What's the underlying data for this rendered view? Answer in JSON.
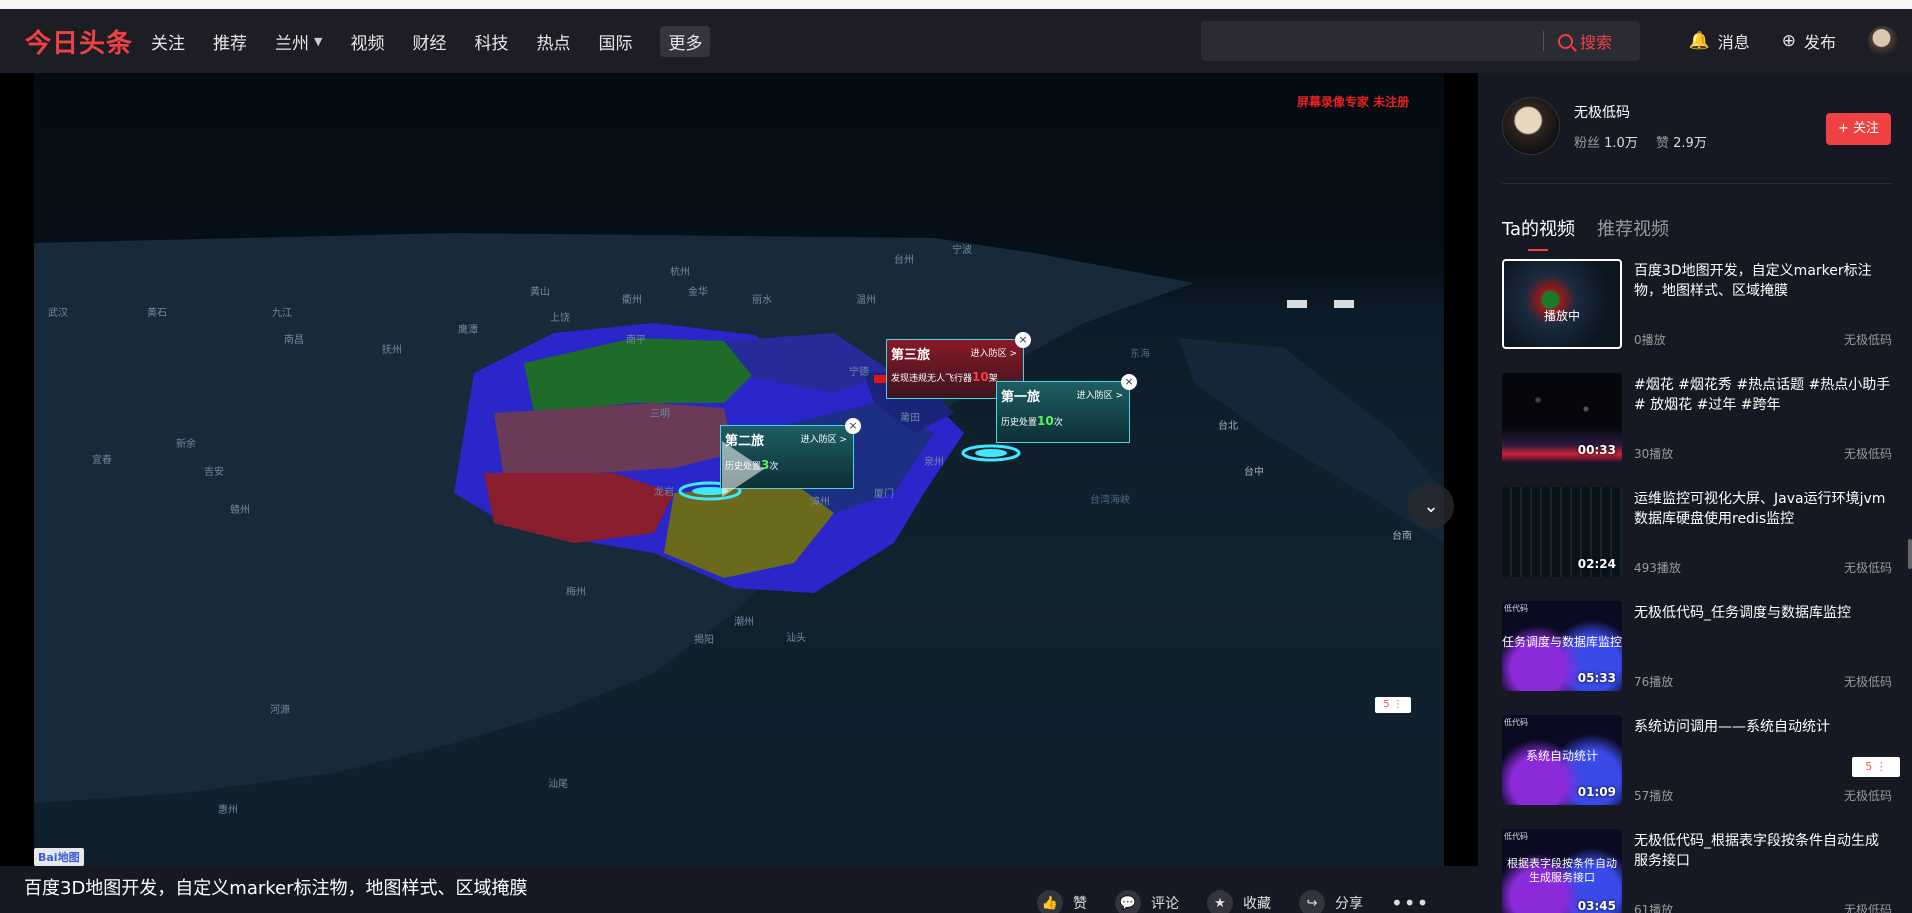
{
  "header": {
    "logo": "今日头条",
    "nav": [
      {
        "label": "关注"
      },
      {
        "label": "推荐"
      },
      {
        "label": "兰州"
      },
      {
        "label": "视频"
      },
      {
        "label": "财经"
      },
      {
        "label": "科技"
      },
      {
        "label": "热点"
      },
      {
        "label": "国际"
      },
      {
        "label": "更多"
      }
    ],
    "search_button": "搜索",
    "search_placeholder": "",
    "messages": "消息",
    "publish": "发布"
  },
  "video": {
    "watermark": "屏幕录像专家 未注册",
    "title": "百度3D地图开发，自定义marker标注物，地图样式、区域掩膜",
    "baidu_logo": "Bai地图",
    "popups": [
      {
        "title": "第三旅",
        "link": "进入防区 >",
        "text_prefix": "发现违规无人飞行器",
        "count": "10",
        "text_suffix": "架"
      },
      {
        "title": "第一旅",
        "link": "进入防区 >",
        "text_prefix": "历史处置",
        "count": "10",
        "text_suffix": "次"
      },
      {
        "title": "第二旅",
        "link": "进入防区 >",
        "text_prefix": "历史处置",
        "count": "3",
        "text_suffix": "次"
      }
    ],
    "map_labels": [
      "武汉",
      "黄石",
      "九江",
      "南昌",
      "抚州",
      "鹰潭",
      "上饶",
      "黄山",
      "衢州",
      "金华",
      "丽水",
      "温州",
      "台州",
      "宁波",
      "杭州",
      "南平",
      "宁德",
      "三明",
      "龙岩",
      "漳州",
      "厦门",
      "泉州",
      "莆田",
      "福州",
      "赣州",
      "梅州",
      "揭阳",
      "汕头",
      "潮州",
      "河源",
      "惠州",
      "汕尾",
      "宜春",
      "新余",
      "吉安",
      "台北",
      "台中",
      "台南",
      "台湾海峡",
      "东海"
    ]
  },
  "actions": [
    {
      "label": "赞"
    },
    {
      "label": "评论"
    },
    {
      "label": "收藏"
    },
    {
      "label": "分享"
    }
  ],
  "author": {
    "name": "无极低码",
    "fans_label": "粉丝",
    "fans": "1.0万",
    "likes_label": "赞",
    "likes": "2.9万",
    "follow": "+ 关注"
  },
  "tabs": [
    {
      "label": "Ta的视频"
    },
    {
      "label": "推荐视频"
    }
  ],
  "videos": [
    {
      "title": "百度3D地图开发，自定义marker标注物，地图样式、区域掩膜",
      "plays": "0播放",
      "author": "无极低码",
      "duration": "",
      "state": "播放中",
      "thumb_text": ""
    },
    {
      "title": "#烟花 #烟花秀 #热点话题 #热点小助手# 放烟花 #过年 #跨年",
      "plays": "30播放",
      "author": "无极低码",
      "duration": "00:33",
      "state": "",
      "thumb_text": ""
    },
    {
      "title": "运维监控可视化大屏、Java运行环境jvm数据库硬盘使用redis监控",
      "plays": "493播放",
      "author": "无极低码",
      "duration": "02:24",
      "state": "",
      "thumb_text": ""
    },
    {
      "title": "无极低代码_任务调度与数据库监控",
      "plays": "76播放",
      "author": "无极低码",
      "duration": "05:33",
      "state": "",
      "thumb_text": "任务调度与数据库监控"
    },
    {
      "title": "系统访问调用——系统自动统计",
      "plays": "57播放",
      "author": "无极低码",
      "duration": "01:09",
      "state": "",
      "thumb_text": "系统自动统计"
    },
    {
      "title": "无极低代码_根据表字段按条件自动生成服务接口",
      "plays": "61播放",
      "author": "无极低码",
      "duration": "03:45",
      "state": "",
      "thumb_text": "根据表字段按条件自动生成服务接口"
    }
  ],
  "thumb_tag": "低代码",
  "colors": {
    "accent": "#f04142",
    "bg": "#161823",
    "header": "#1c1d25"
  }
}
